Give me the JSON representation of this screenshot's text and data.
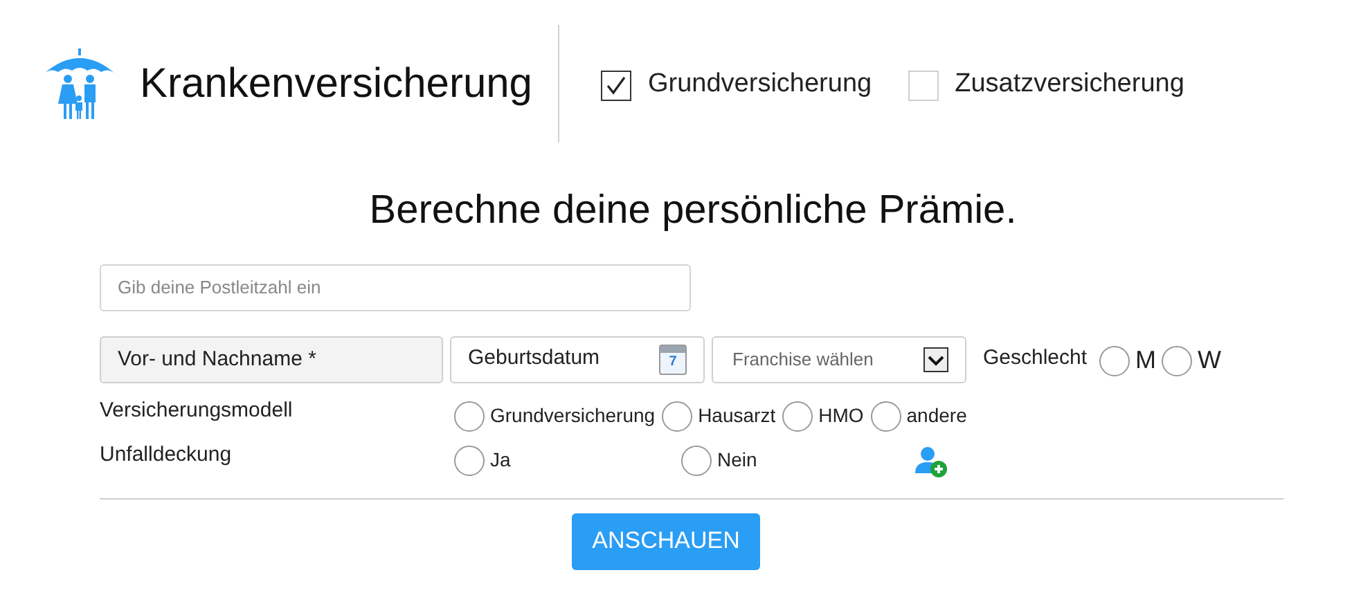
{
  "header": {
    "title": "Krankenversicherung",
    "options": [
      {
        "label": "Grundversicherung",
        "checked": true
      },
      {
        "label": "Zusatzversicherung",
        "checked": false
      }
    ]
  },
  "heading": "Berechne deine persönliche Prämie.",
  "zip_field": {
    "placeholder": "Gib deine Postleitzahl ein"
  },
  "name_field": {
    "placeholder": "Vor- und Nachname *"
  },
  "birthdate_field": {
    "placeholder": "Geburtsdatum",
    "calendar_day": "7"
  },
  "franchise_select": {
    "value": "Franchise wählen"
  },
  "gender": {
    "label": "Geschlecht",
    "options": [
      {
        "label": "M",
        "selected": false
      },
      {
        "label": "W",
        "selected": false
      }
    ]
  },
  "insurance_model": {
    "label": "Versicherungsmodell",
    "options": [
      {
        "label": "Grundversicherung",
        "selected": false
      },
      {
        "label": "Hausarzt",
        "selected": false
      },
      {
        "label": "HMO",
        "selected": false
      },
      {
        "label": "andere",
        "selected": false
      }
    ]
  },
  "accident_cover": {
    "label": "Unfalldeckung",
    "options": [
      {
        "label": "Ja",
        "selected": false
      },
      {
        "label": "Nein",
        "selected": false
      }
    ]
  },
  "submit_button": "ANSCHAUEN"
}
